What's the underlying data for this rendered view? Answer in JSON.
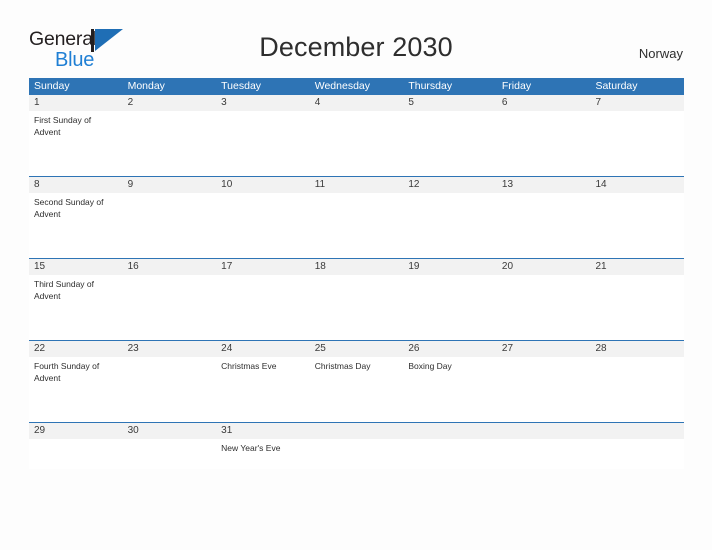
{
  "brand": {
    "name_part1": "General",
    "name_part2": "Blue",
    "mark": "sailboat-logo-icon",
    "color_dark": "#231f20",
    "color_blue": "#1f7fd4"
  },
  "header": {
    "title": "December 2030",
    "country": "Norway"
  },
  "theme": {
    "header_blue": "#2e74b5",
    "date_band_gray": "#f2f2f2",
    "page_background": "#fdfdfd"
  },
  "calendar": {
    "weekdays": [
      "Sunday",
      "Monday",
      "Tuesday",
      "Wednesday",
      "Thursday",
      "Friday",
      "Saturday"
    ],
    "weeks": [
      {
        "dates": [
          "1",
          "2",
          "3",
          "4",
          "5",
          "6",
          "7"
        ],
        "events": [
          "First Sunday of Advent",
          "",
          "",
          "",
          "",
          "",
          ""
        ]
      },
      {
        "dates": [
          "8",
          "9",
          "10",
          "11",
          "12",
          "13",
          "14"
        ],
        "events": [
          "Second Sunday of Advent",
          "",
          "",
          "",
          "",
          "",
          ""
        ]
      },
      {
        "dates": [
          "15",
          "16",
          "17",
          "18",
          "19",
          "20",
          "21"
        ],
        "events": [
          "Third Sunday of Advent",
          "",
          "",
          "",
          "",
          "",
          ""
        ]
      },
      {
        "dates": [
          "22",
          "23",
          "24",
          "25",
          "26",
          "27",
          "28"
        ],
        "events": [
          "Fourth Sunday of Advent",
          "",
          "Christmas Eve",
          "Christmas Day",
          "Boxing Day",
          "",
          ""
        ]
      },
      {
        "dates": [
          "29",
          "30",
          "31",
          "",
          "",
          "",
          ""
        ],
        "events": [
          "",
          "",
          "New Year's Eve",
          "",
          "",
          "",
          ""
        ]
      }
    ]
  }
}
